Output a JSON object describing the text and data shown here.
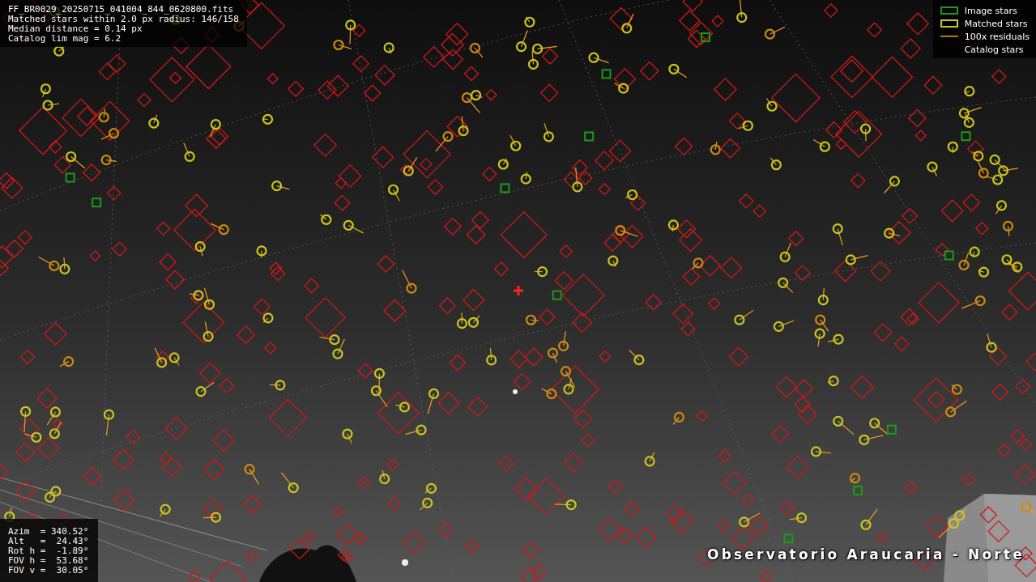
{
  "header": [
    "FF_BR0029_20250715_041004_844_0620800.fits",
    "Matched stars within 2.0 px radius: 146/158",
    "Median distance = 0.14 px",
    "Catalog lim mag = 6.2"
  ],
  "legend": [
    {
      "label": "Image stars"
    },
    {
      "kind": "matched",
      "label": "Matched stars"
    },
    {
      "kind": "residual",
      "label": "100x residuals"
    },
    {
      "kind": "catalog",
      "label": "Catalog stars"
    }
  ],
  "pointing": [
    "Azim  = 340.52°",
    "Alt   =  24.43°",
    "Rot h =  -1.89°",
    "FOV h =  53.68°",
    "FOV v =  30.05°"
  ],
  "station_label": "Observatorio Araucaria - Norte"
}
